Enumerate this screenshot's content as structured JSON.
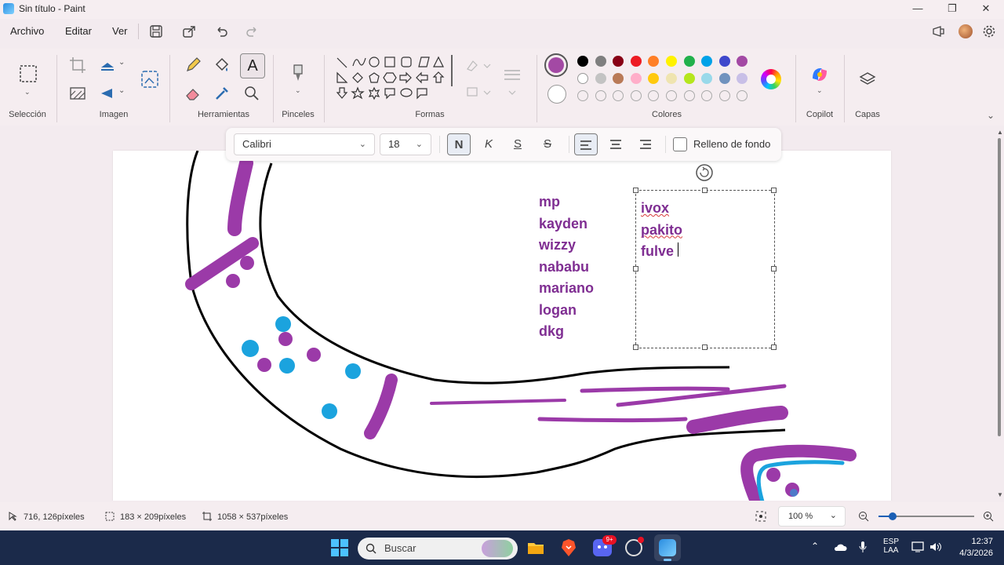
{
  "window": {
    "title": "Sin título - Paint"
  },
  "menu": {
    "file": "Archivo",
    "edit": "Editar",
    "view": "Ver"
  },
  "ribbon": {
    "groups": {
      "selection": "Selección",
      "image": "Imagen",
      "tools": "Herramientas",
      "brushes": "Pinceles",
      "shapes": "Formas",
      "colors": "Colores",
      "copilot": "Copilot",
      "layers": "Capas"
    },
    "palette_row1": [
      "#000000",
      "#7f7f7f",
      "#880015",
      "#ed1c24",
      "#ff7f27",
      "#fff200",
      "#22b14c",
      "#00a2e8",
      "#3f48cc",
      "#a349a4"
    ],
    "palette_row2": [
      "#ffffff",
      "#c3c3c3",
      "#b97a57",
      "#ffaec9",
      "#ffc90e",
      "#efe4b0",
      "#b5e61d",
      "#99d9ea",
      "#7092be",
      "#c8bfe7"
    ],
    "primary_color": "#a349a4",
    "secondary_color": "#ffffff"
  },
  "text_toolbar": {
    "font": "Calibri",
    "size": "18",
    "bold": "N",
    "italic": "K",
    "underline": "S",
    "strike": "S",
    "fill_label": "Relleno de fondo"
  },
  "canvas": {
    "names_list": [
      "mp",
      "kayden",
      "wizzy",
      "nababu",
      "mariano",
      "logan",
      "dkg"
    ],
    "textbox_lines": [
      "ivox",
      "pakito",
      "fulve"
    ]
  },
  "status": {
    "cursor": "716, 126píxeles",
    "selection": "183 × 209píxeles",
    "canvas_size": "1058 × 537píxeles",
    "zoom": "100 %"
  },
  "taskbar": {
    "search_placeholder": "Buscar",
    "lang": "ESP",
    "lang2": "LAA",
    "time": "12:37",
    "date": "4/3/2026",
    "discord_badge": "9+"
  }
}
